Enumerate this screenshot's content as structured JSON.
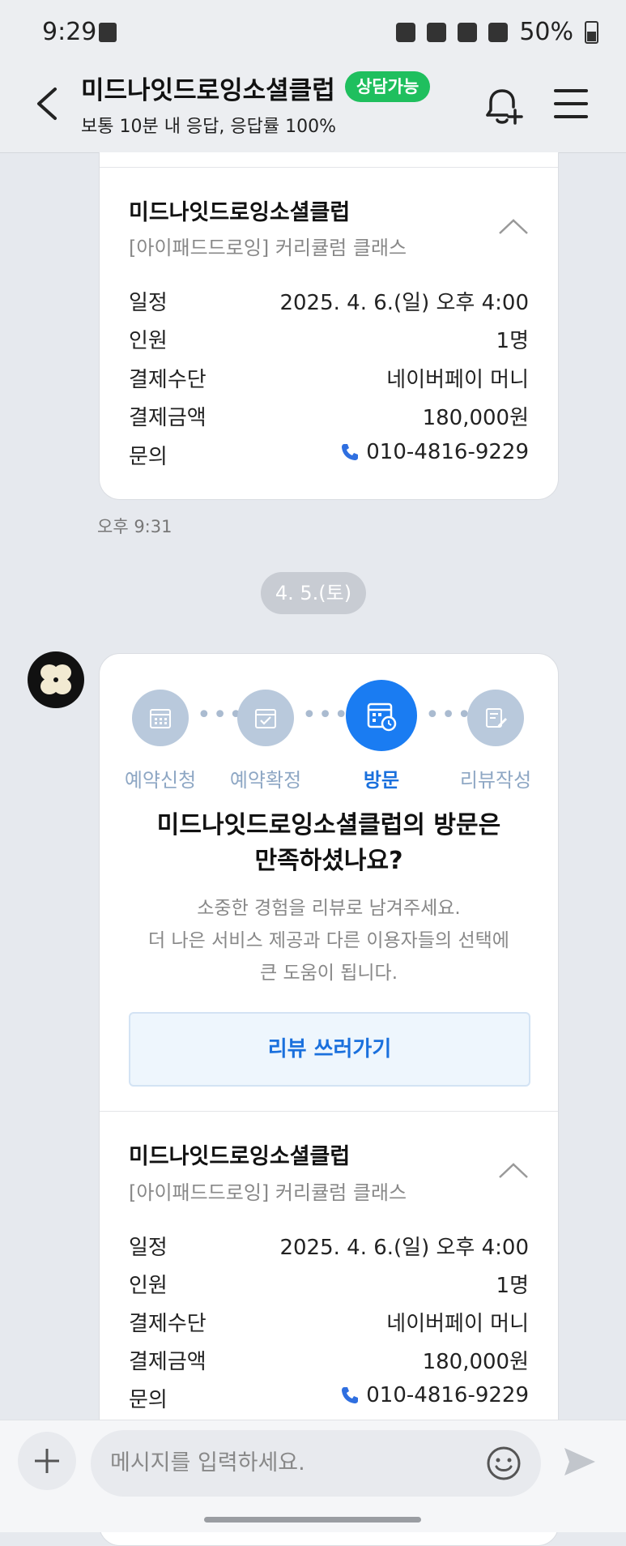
{
  "status_bar": {
    "time": "9:29",
    "battery": "50%",
    "icons": [
      "alarm-icon",
      "mute-icon",
      "wifi-icon",
      "hd-voice-icon",
      "signal-icon",
      "battery-icon"
    ]
  },
  "header": {
    "title": "미드나잇드로잉소셜클럽",
    "badge": "상담가능",
    "subtitle": "보통 10분 내 응답, 응답률 100%"
  },
  "booking_card_1": {
    "shop_name": "미드나잇드로잉소셜클럽",
    "class_name": "[아이패드드로잉] 커리큘럼 클래스",
    "rows": [
      {
        "label": "일정",
        "value": "2025. 4. 6.(일) 오후 4:00"
      },
      {
        "label": "인원",
        "value": "1명"
      },
      {
        "label": "결제수단",
        "value": "네이버페이 머니"
      },
      {
        "label": "결제금액",
        "value": "180,000원"
      },
      {
        "label": "문의",
        "value": "010-4816-9229"
      }
    ]
  },
  "timestamp": "오후 9:31",
  "date_separator": "4. 5.(토)",
  "review_card": {
    "steps": [
      {
        "label": "예약신청",
        "icon": "calendar-icon"
      },
      {
        "label": "예약확정",
        "icon": "calendar-check-icon"
      },
      {
        "label": "방문",
        "icon": "calendar-clock-icon"
      },
      {
        "label": "리뷰작성",
        "icon": "edit-note-icon"
      }
    ],
    "active_step": 2,
    "title_line1": "미드나잇드로잉소셜클럽의 방문은",
    "title_line2": "만족하셨나요?",
    "desc_line1": "소중한 경험을 리뷰로 남겨주세요.",
    "desc_line2": "더 나은 서비스 제공과 다른 이용자들의 선택에",
    "desc_line3": "큰 도움이 됩니다.",
    "button": "리뷰 쓰러가기"
  },
  "booking_card_2": {
    "shop_name": "미드나잇드로잉소셜클럽",
    "class_name": "[아이패드드로잉] 커리큘럼 클래스",
    "rows": [
      {
        "label": "일정",
        "value": "2025. 4. 6.(일) 오후 4:00"
      },
      {
        "label": "인원",
        "value": "1명"
      },
      {
        "label": "결제수단",
        "value": "네이버페이 머니"
      },
      {
        "label": "결제금액",
        "value": "180,000원"
      },
      {
        "label": "문의",
        "value": "010-4816-9229"
      }
    ]
  },
  "composer": {
    "placeholder": "메시지를 입력하세요."
  },
  "colors": {
    "accent_blue": "#1a7cf2",
    "badge_green": "#1fbf5e",
    "background": "#e6e9ee"
  }
}
